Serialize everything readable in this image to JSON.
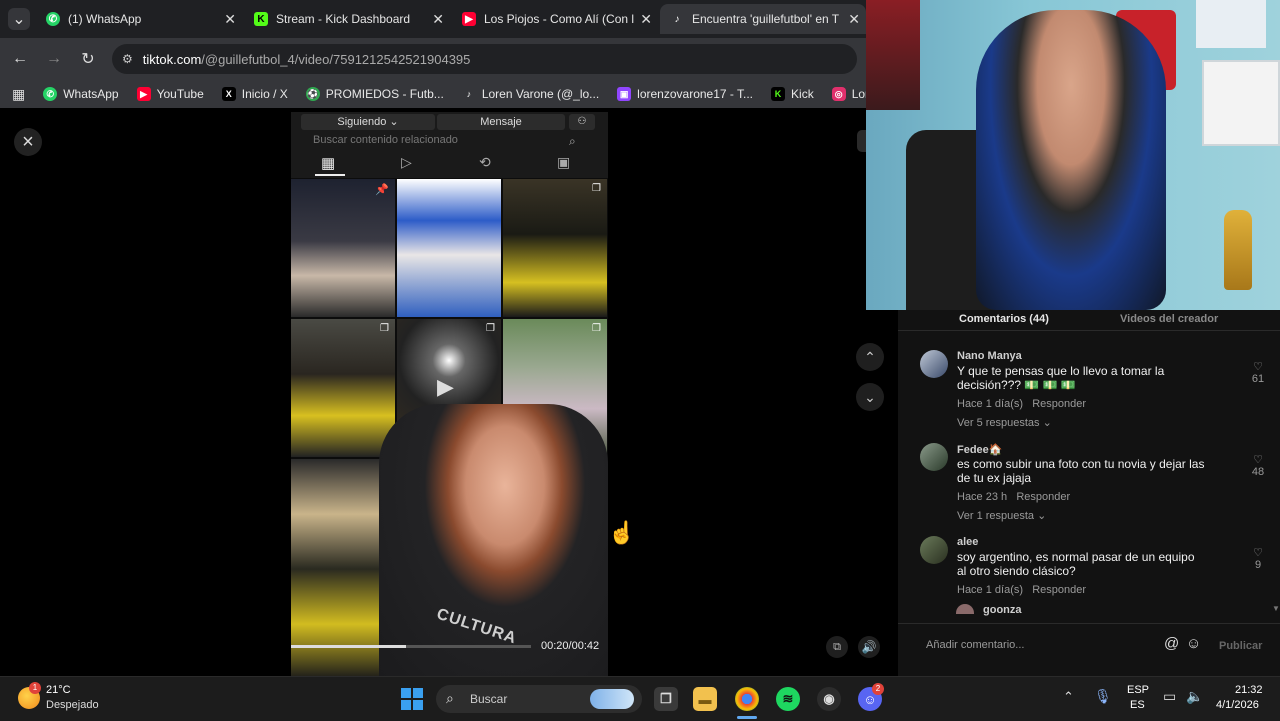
{
  "browser": {
    "tabs": [
      {
        "title": "(1) WhatsApp",
        "icon": "whatsapp-icon",
        "color": "#25d366"
      },
      {
        "title": "Stream - Kick Dashboard",
        "icon": "kick-icon",
        "color": "#53fc18"
      },
      {
        "title": "Los Piojos - Como Alí (Con l",
        "icon": "youtube-icon",
        "color": "#ff0033"
      },
      {
        "title": "Encuentra 'guillefutbol' en T",
        "icon": "tiktok-icon",
        "color": "#ffffff"
      }
    ],
    "url_domain": "tiktok.com",
    "url_path": "/@guillefutbol_4/video/7591212542521904395",
    "bookmarks": [
      {
        "label": "WhatsApp",
        "icon": "whatsapp-icon",
        "color": "#25d366"
      },
      {
        "label": "YouTube",
        "icon": "youtube-icon",
        "color": "#ff0033"
      },
      {
        "label": "Inicio / X",
        "icon": "x-icon",
        "color": "#ffffff"
      },
      {
        "label": "PROMIEDOS - Futb...",
        "icon": "promiedos-icon",
        "color": "#2fa84f"
      },
      {
        "label": "Loren Varone (@_lo...",
        "icon": "tiktok-icon",
        "color": "#ffffff"
      },
      {
        "label": "lorenzovarone17 - T...",
        "icon": "twitch-icon",
        "color": "#9146ff"
      },
      {
        "label": "Kick",
        "icon": "kick-icon",
        "color": "#53fc18"
      },
      {
        "label": "Lorenzova",
        "icon": "instagram-icon",
        "color": "#e1306c"
      }
    ]
  },
  "video": {
    "following_label": "Siguiendo",
    "message_label": "Mensaje",
    "search_placeholder": "Buscar contenido relacionado",
    "time": "00:20/00:42",
    "progress": 0.48,
    "overlay_text": "CULTURA"
  },
  "comments": {
    "tab_comments": "Comentarios (44)",
    "tab_videos": "Videos del creador",
    "items": [
      {
        "user": "Nano Manya",
        "text": "Y que te pensas que lo llevo a tomar la decisión??? 💵 💵 💵",
        "time": "Hace 1 día(s)",
        "reply": "Responder",
        "more": "Ver 5 respuestas",
        "likes": "61"
      },
      {
        "user": "Fedee🏠",
        "text": "es como subir una foto con tu novia y dejar las de tu ex jajaja",
        "time": "Hace 23 h",
        "reply": "Responder",
        "more": "Ver 1 respuesta",
        "likes": "48"
      },
      {
        "user": "alee",
        "text": "soy argentino, es normal pasar de un equipo al otro siendo clásico?",
        "time": "Hace 1 día(s)",
        "reply": "Responder",
        "more": "",
        "likes": "9"
      }
    ],
    "next_user": "goonza",
    "add_comment_placeholder": "Añadir comentario...",
    "publish_label": "Publicar"
  },
  "taskbar": {
    "weather_temp": "21°C",
    "weather_desc": "Despejado",
    "weather_badge": "1",
    "search_label": "Buscar",
    "lang_top": "ESP",
    "lang_bottom": "ES",
    "time": "21:32",
    "date": "4/1/2026",
    "discord_badge": "2"
  }
}
